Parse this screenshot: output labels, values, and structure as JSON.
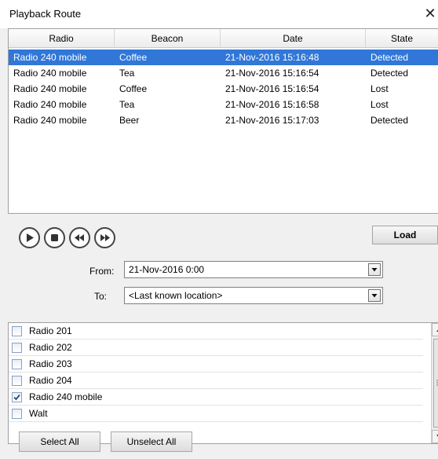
{
  "window": {
    "title": "Playback Route",
    "close_glyph": "✕"
  },
  "table": {
    "columns": [
      "Radio",
      "Beacon",
      "Date",
      "State"
    ],
    "rows": [
      {
        "radio": "Radio 240 mobile",
        "beacon": "Coffee",
        "date": "21-Nov-2016 15:16:48",
        "state": "Detected",
        "selected": true
      },
      {
        "radio": "Radio 240 mobile",
        "beacon": "Tea",
        "date": "21-Nov-2016 15:16:54",
        "state": "Detected",
        "selected": false
      },
      {
        "radio": "Radio 240 mobile",
        "beacon": "Coffee",
        "date": "21-Nov-2016 15:16:54",
        "state": "Lost",
        "selected": false
      },
      {
        "radio": "Radio 240 mobile",
        "beacon": "Tea",
        "date": "21-Nov-2016 15:16:58",
        "state": "Lost",
        "selected": false
      },
      {
        "radio": "Radio 240 mobile",
        "beacon": "Beer",
        "date": "21-Nov-2016 15:17:03",
        "state": "Detected",
        "selected": false
      }
    ]
  },
  "playback": {
    "buttons": [
      "play-icon",
      "stop-icon",
      "rewind-icon",
      "fast-forward-icon"
    ],
    "load_label": "Load"
  },
  "filters": {
    "from_label": "From:",
    "from_value": "21-Nov-2016 0:00",
    "to_label": "To:",
    "to_value": "<Last known location>"
  },
  "radio_list": {
    "items": [
      {
        "label": "Radio 201",
        "checked": false
      },
      {
        "label": "Radio 202",
        "checked": false
      },
      {
        "label": "Radio 203",
        "checked": false
      },
      {
        "label": "Radio 204",
        "checked": false
      },
      {
        "label": "Radio 240 mobile",
        "checked": true
      },
      {
        "label": "Walt",
        "checked": false
      }
    ]
  },
  "actions": {
    "select_all": "Select All",
    "unselect_all": "Unselect All"
  },
  "colors": {
    "selection": "#3077d7",
    "window_bg": "#f0f0f0"
  }
}
